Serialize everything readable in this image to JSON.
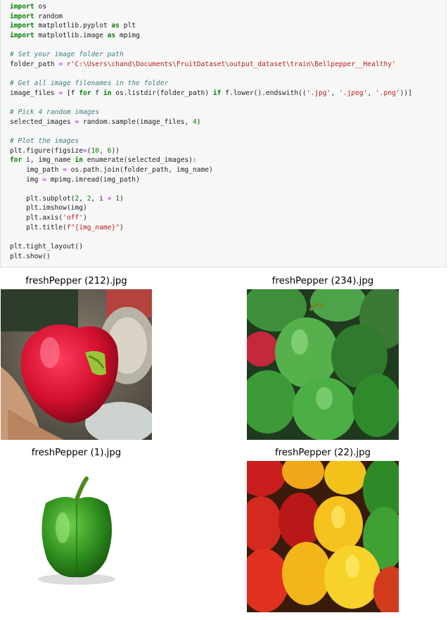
{
  "code_cell": {
    "lines": [
      [
        {
          "t": "import",
          "c": "kw"
        },
        {
          "t": " os"
        }
      ],
      [
        {
          "t": "import",
          "c": "kw"
        },
        {
          "t": " random"
        }
      ],
      [
        {
          "t": "import",
          "c": "kw"
        },
        {
          "t": " matplotlib.pyplot "
        },
        {
          "t": "as",
          "c": "kw"
        },
        {
          "t": " plt"
        }
      ],
      [
        {
          "t": "import",
          "c": "kw"
        },
        {
          "t": " matplotlib.image "
        },
        {
          "t": "as",
          "c": "kw"
        },
        {
          "t": " mpimg"
        }
      ],
      [
        {
          "t": ""
        }
      ],
      [
        {
          "t": "# Set your image folder path",
          "c": "cm"
        }
      ],
      [
        {
          "t": "folder_path "
        },
        {
          "t": "=",
          "c": "op"
        },
        {
          "t": " "
        },
        {
          "t": "r'C:\\Users\\chand\\Documents\\FruitDataset\\output_dataset\\train\\Bellpepper__Healthy'",
          "c": "str"
        }
      ],
      [
        {
          "t": ""
        }
      ],
      [
        {
          "t": "# Get all image filenames in the folder",
          "c": "cm"
        }
      ],
      [
        {
          "t": "image_files "
        },
        {
          "t": "=",
          "c": "op"
        },
        {
          "t": " [f "
        },
        {
          "t": "for",
          "c": "kw"
        },
        {
          "t": " f "
        },
        {
          "t": "in",
          "c": "kw"
        },
        {
          "t": " os.listdir(folder_path) "
        },
        {
          "t": "if",
          "c": "kw"
        },
        {
          "t": " f.lower().endswith(("
        },
        {
          "t": "'.jpg'",
          "c": "str"
        },
        {
          "t": ", "
        },
        {
          "t": "'.jpeg'",
          "c": "str"
        },
        {
          "t": ", "
        },
        {
          "t": "'.png'",
          "c": "str"
        },
        {
          "t": "))]"
        }
      ],
      [
        {
          "t": ""
        }
      ],
      [
        {
          "t": "# Pick 4 random images",
          "c": "cm"
        }
      ],
      [
        {
          "t": "selected_images "
        },
        {
          "t": "=",
          "c": "op"
        },
        {
          "t": " random.sample(image_files, "
        },
        {
          "t": "4",
          "c": "num"
        },
        {
          "t": ")"
        }
      ],
      [
        {
          "t": ""
        }
      ],
      [
        {
          "t": "# Plot the images",
          "c": "cm"
        }
      ],
      [
        {
          "t": "plt.figure(figsize"
        },
        {
          "t": "=",
          "c": "op"
        },
        {
          "t": "("
        },
        {
          "t": "10",
          "c": "num"
        },
        {
          "t": ", "
        },
        {
          "t": "6",
          "c": "num"
        },
        {
          "t": "))"
        }
      ],
      [
        {
          "t": "for",
          "c": "kw"
        },
        {
          "t": " i, img_name "
        },
        {
          "t": "in",
          "c": "kw"
        },
        {
          "t": " enumerate(selected_images):"
        }
      ],
      [
        {
          "t": "    img_path "
        },
        {
          "t": "=",
          "c": "op"
        },
        {
          "t": " os.path.join(folder_path, img_name)"
        }
      ],
      [
        {
          "t": "    img "
        },
        {
          "t": "=",
          "c": "op"
        },
        {
          "t": " mpimg.imread(img_path)"
        }
      ],
      [
        {
          "t": ""
        }
      ],
      [
        {
          "t": "    plt.subplot("
        },
        {
          "t": "2",
          "c": "num"
        },
        {
          "t": ", "
        },
        {
          "t": "2",
          "c": "num"
        },
        {
          "t": ", i "
        },
        {
          "t": "+",
          "c": "op"
        },
        {
          "t": " "
        },
        {
          "t": "1",
          "c": "num"
        },
        {
          "t": ")"
        }
      ],
      [
        {
          "t": "    plt.imshow(img)"
        }
      ],
      [
        {
          "t": "    plt.axis("
        },
        {
          "t": "'off'",
          "c": "str"
        },
        {
          "t": ")"
        }
      ],
      [
        {
          "t": "    plt.title("
        },
        {
          "t": "f\"{img_name}\"",
          "c": "str"
        },
        {
          "t": ")"
        }
      ],
      [
        {
          "t": ""
        }
      ],
      [
        {
          "t": "plt.tight_layout()"
        }
      ],
      [
        {
          "t": "plt.show()"
        }
      ]
    ]
  },
  "output": {
    "subplots": [
      {
        "title": "freshPepper (212).jpg"
      },
      {
        "title": "freshPepper (234).jpg"
      },
      {
        "title": "freshPepper (1).jpg"
      },
      {
        "title": "freshPepper (22).jpg"
      }
    ]
  },
  "colors": {
    "cell_background": "#f7f7f7",
    "keyword": "#008000",
    "comment": "#408080",
    "string": "#ba2121",
    "operator": "#aa22ff"
  }
}
